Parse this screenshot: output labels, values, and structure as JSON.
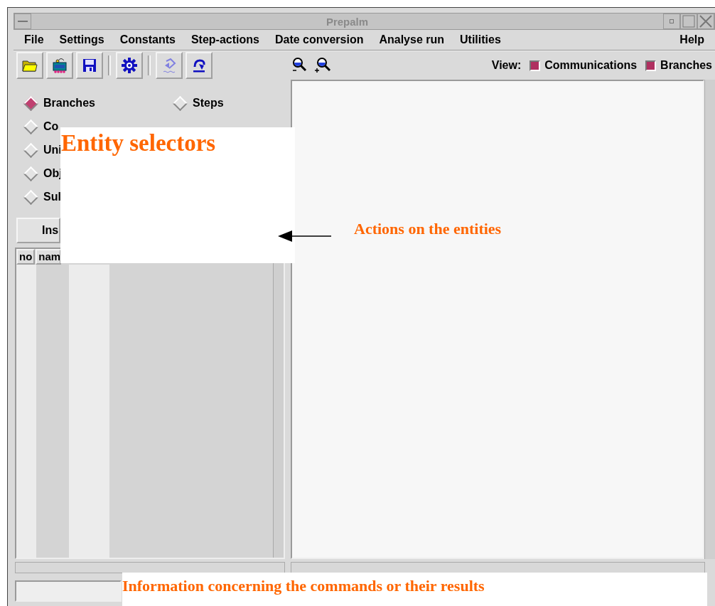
{
  "window": {
    "title": "Prepalm"
  },
  "menu": [
    {
      "label": "File"
    },
    {
      "label": "Settings"
    },
    {
      "label": "Constants"
    },
    {
      "label": "Step-actions"
    },
    {
      "label": "Date conversion"
    },
    {
      "label": "Analyse run"
    },
    {
      "label": "Utilities"
    },
    {
      "label": "Help"
    }
  ],
  "view": {
    "label": "View:",
    "options": [
      {
        "label": "Communications",
        "checked": true
      },
      {
        "label": "Branches",
        "checked": true
      }
    ]
  },
  "entity_selectors": {
    "left": [
      {
        "label": "Branches",
        "selected": true
      },
      {
        "label": "Co",
        "selected": false
      },
      {
        "label": "Uni",
        "selected": false
      },
      {
        "label": "Obj",
        "selected": false
      },
      {
        "label": "Sul",
        "selected": false
      }
    ],
    "right": [
      {
        "label": "Steps",
        "selected": false
      }
    ]
  },
  "action_button": {
    "label": "Ins"
  },
  "table": {
    "columns": [
      "no",
      "nam"
    ]
  },
  "annotations": [
    {
      "text": "Entity selectors"
    },
    {
      "text": "Actions on the entities"
    },
    {
      "text": "Information concerning the commands or their results"
    }
  ]
}
